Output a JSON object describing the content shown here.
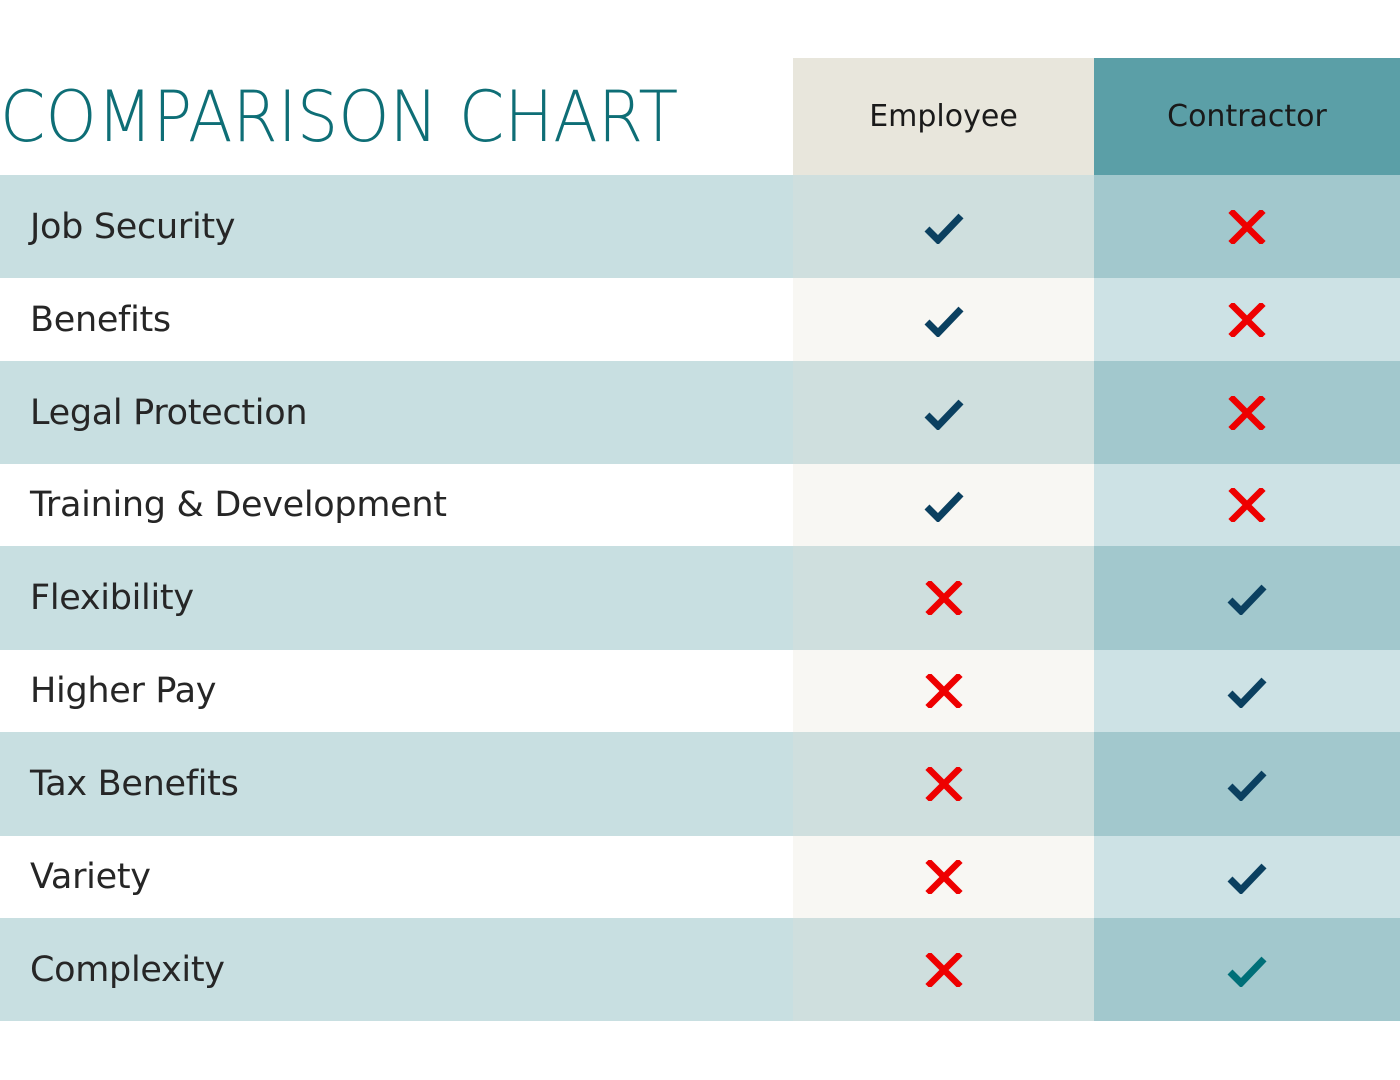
{
  "title": "COMPARISON CHART",
  "columns": [
    {
      "key": "employee",
      "label": "Employee"
    },
    {
      "key": "contractor",
      "label": "Contractor"
    }
  ],
  "colors": {
    "title": "#0e6e76",
    "check": "#0b4060",
    "check_alt": "#006f78",
    "cross": "#ee0000",
    "employee_header": "#e8e6dc",
    "contractor_header": "#5b9fa7"
  },
  "rows": [
    {
      "label": "Job Security",
      "employee": "check",
      "contractor": "cross"
    },
    {
      "label": "Benefits",
      "employee": "check",
      "contractor": "cross"
    },
    {
      "label": "Legal Protection",
      "employee": "check",
      "contractor": "cross"
    },
    {
      "label": "Training & Development",
      "employee": "check",
      "contractor": "cross"
    },
    {
      "label": "Flexibility",
      "employee": "cross",
      "contractor": "check"
    },
    {
      "label": "Higher Pay",
      "employee": "cross",
      "contractor": "check"
    },
    {
      "label": "Tax Benefits",
      "employee": "cross",
      "contractor": "check"
    },
    {
      "label": "Variety",
      "employee": "cross",
      "contractor": "check"
    },
    {
      "label": "Complexity",
      "employee": "cross",
      "contractor": "check-alt"
    }
  ]
}
